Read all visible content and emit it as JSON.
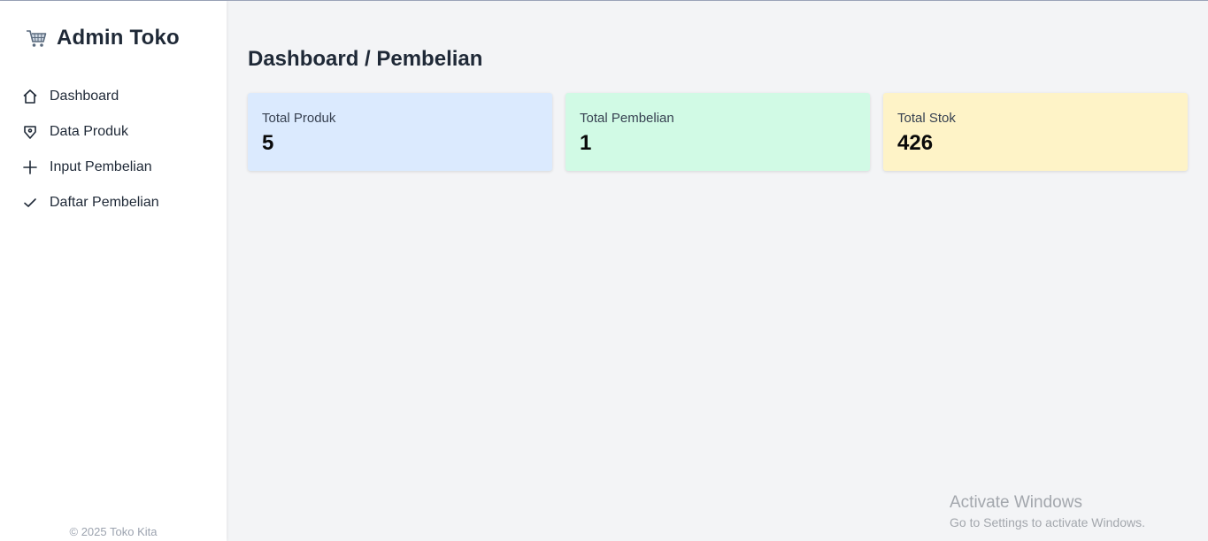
{
  "sidebar": {
    "brand": {
      "icon": "cart-icon",
      "title": "Admin Toko"
    },
    "items": [
      {
        "label": "Dashboard",
        "icon": "home-icon"
      },
      {
        "label": "Data Produk",
        "icon": "tag-icon"
      },
      {
        "label": "Input Pembelian",
        "icon": "plus-icon"
      },
      {
        "label": "Daftar Pembelian",
        "icon": "check-icon"
      }
    ],
    "footer": "© 2025 Toko Kita"
  },
  "main": {
    "title": "Dashboard / Pembelian",
    "cards": [
      {
        "label": "Total Produk",
        "value": "5",
        "color": "#dbeafe"
      },
      {
        "label": "Total Pembelian",
        "value": "1",
        "color": "#d1fae5"
      },
      {
        "label": "Total Stok",
        "value": "426",
        "color": "#fef3c7"
      }
    ]
  },
  "watermark": {
    "title": "Activate Windows",
    "subtitle": "Go to Settings to activate Windows."
  }
}
